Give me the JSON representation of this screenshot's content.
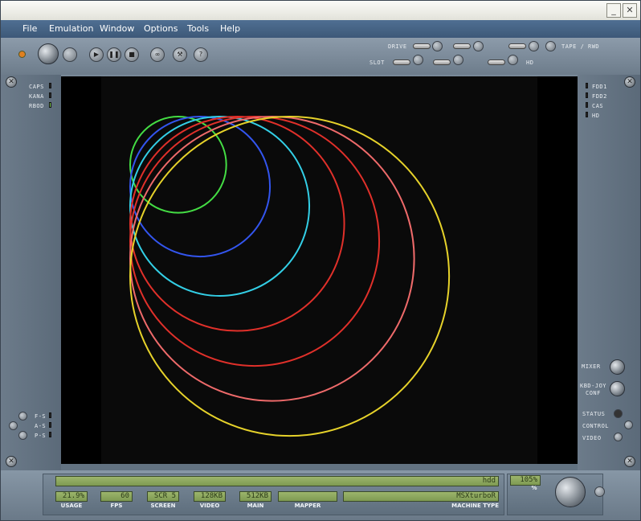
{
  "menu": {
    "file": "File",
    "emulation": "Emulation",
    "window": "Window",
    "options": "Options",
    "tools": "Tools",
    "help": "Help"
  },
  "titlebar": {
    "minimize": "_",
    "close": "✕"
  },
  "toolbar": {
    "drive": "DRIVE",
    "slot": "SLOT",
    "tape": "TAPE / RWD",
    "hd": "HD"
  },
  "left_leds": {
    "caps": "CAPS",
    "kana": "KANA",
    "turbo": "RBOD"
  },
  "right_leds": {
    "fdd1": "FDD1",
    "fdd2": "FDD2",
    "cas": "CAS",
    "hd": "HD"
  },
  "left_bottom": {
    "fs": "F-S",
    "as": "A-S",
    "ps": "P-S"
  },
  "right_panel": {
    "mixer": "MIXER",
    "kbd": "KBD-JOY",
    "conf": "CONF",
    "status": "STATUS",
    "control": "CONTROL",
    "video": "VIDEO"
  },
  "status": {
    "hdd_label": "hdd",
    "usage": "21.9%",
    "usage_label": "USAGE",
    "fps": "60",
    "fps_label": "FPS",
    "screen": "SCR 5",
    "screen_label": "SCREEN",
    "video": "128KB",
    "video_label": "VIDEO",
    "main": "512KB",
    "main_label": "MAIN",
    "mapper": "",
    "mapper_label": "MAPPER",
    "machine": "MSXturboR",
    "machine_label": "MACHINE TYPE",
    "speed": "105%",
    "speed_unit": "%"
  },
  "colors": {
    "green": "#44dd44",
    "blue": "#3355ee",
    "cyan": "#33cfe6",
    "red": "#e0302a",
    "pink": "#ee6a6a",
    "yellow": "#e6d22a"
  },
  "circles": [
    {
      "color": "green",
      "r": 0.44
    },
    {
      "color": "blue",
      "r": 0.64
    },
    {
      "color": "cyan",
      "r": 0.82
    },
    {
      "color": "red",
      "r": 0.98
    },
    {
      "color": "red",
      "r": 1.14
    },
    {
      "color": "pink",
      "r": 1.3
    },
    {
      "color": "yellow",
      "r": 1.46
    }
  ]
}
